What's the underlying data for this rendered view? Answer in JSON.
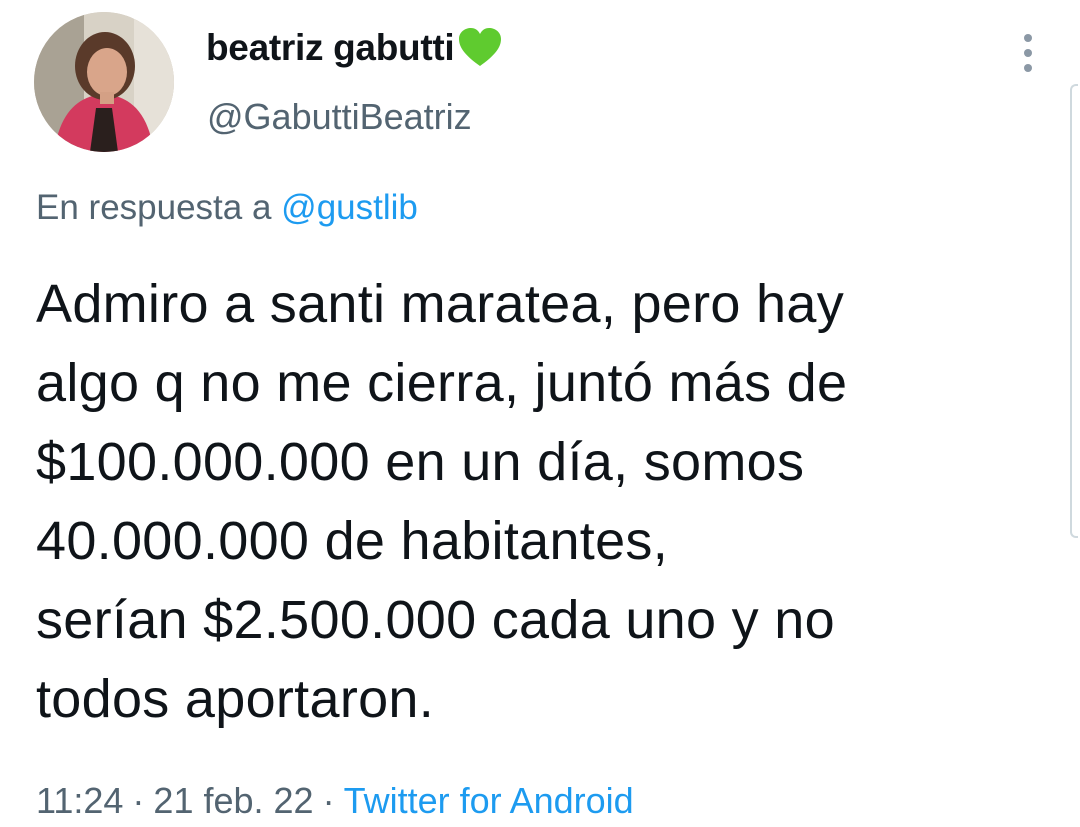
{
  "tweet": {
    "author": {
      "display_name": "beatriz gabutti",
      "badge_icon": "green-heart-icon",
      "badge_color": "#5fcb2f",
      "handle": "@GabuttiBeatriz"
    },
    "reply": {
      "prefix": "En respuesta a",
      "mention": "@gustlib"
    },
    "text": "Admiro a santi maratea, pero hay\nalgo q no me cierra, juntó más  de\n$100.000.000 en un día,  somos\n40.000.000 de habitantes,\nserían $2.500.000 cada uno y no\ntodos aportaron.",
    "meta": {
      "time": "11:24",
      "separator": "·",
      "date": "21 feb. 22",
      "source": "Twitter for Android"
    }
  },
  "colors": {
    "text_primary": "#0f1419",
    "text_secondary": "#536471",
    "link": "#1d9bf0"
  }
}
